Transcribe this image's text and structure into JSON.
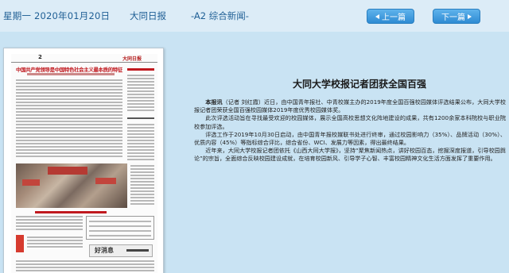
{
  "header": {
    "date": "星期一 2020年01月20日",
    "paper_name": "大同日报",
    "section": "-A2 综合新闻-",
    "prev_label": "上一篇",
    "next_label": "下一篇"
  },
  "thumbnail": {
    "page_number": "2",
    "masthead": "大同日报",
    "headline": "中国共产党领导是中国特色社会主义最本质的特征",
    "ad_text": "好消息"
  },
  "article": {
    "title": "大同大学校报记者团获全国百强",
    "lead_tag": "本报讯",
    "paragraphs": [
      "（记者 刘红霞）近日，由中国青年报社、中青校媒主办的2019年度全国百强校园媒体评选结果公布，大同大学校报记者团荣获全国百强校园媒体2019年度优秀校园媒体奖。",
      "此次评选活动旨在寻找最受欢迎的校园媒体，展示全国高校思想文化阵地建设的成果，共有1200余家本科院校与职业院校参加评选。",
      "评选工作于2019年10月30日启动，由中国青年报校媒联书处进行终审，通过校园影响力（35%）、品牌活动（30%）、优质内容（45%）等指标综合评比，综合省份、WCI、发展力等因素，得出最终结果。",
      "近年来，大同大学校报记者团依托《山西大同大学报》，坚持“聚焦新闻热点，讲好校园百态，挖掘深度报道，引导校园舆论”的宗旨，全面综合反映校园建设成就，在培育校园新风、引导学子心智、丰富校园精神文化生活方面发挥了重要作用。"
    ]
  },
  "colors": {
    "background": "#c9e3f3",
    "header_text": "#1f5f95",
    "button": "#2e8bd3"
  }
}
